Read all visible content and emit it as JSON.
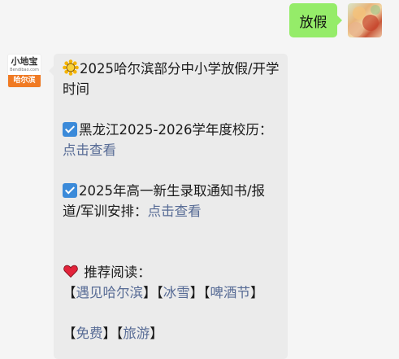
{
  "outgoing": {
    "text": "放假"
  },
  "bot": {
    "logo_top": "小地宝",
    "logo_mid": "Bendibao.com",
    "logo_band": "哈尔滨"
  },
  "message": {
    "title": "2025哈尔滨部分中小学放假/开学时间",
    "item1_text": "黑龙江2025-2026学年度校历：",
    "item1_link": "点击查看",
    "item2_text": "2025年高一新生录取通知书/报道/军训安排：",
    "item2_link": "点击查看",
    "recommend_label": "推荐阅读：",
    "tags_row1": {
      "t1": "遇见哈尔滨",
      "t2": "冰雪",
      "t3": "啤酒节"
    },
    "tags_row2": {
      "t1": "免费",
      "t2": "旅游"
    },
    "bracket_open": "【",
    "bracket_close": "】"
  },
  "icons": {
    "title_icon": "sunflower-icon",
    "item_icon": "checkbox-icon",
    "recommend_icon": "heart-icon"
  }
}
